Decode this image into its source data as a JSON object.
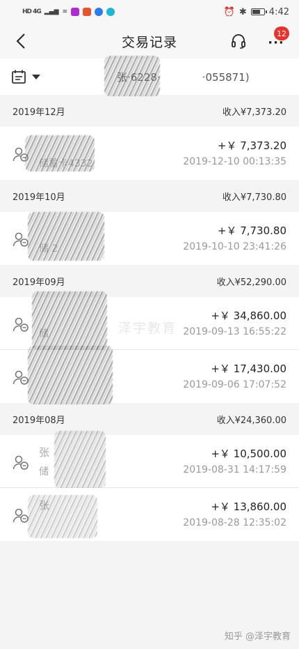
{
  "status_bar": {
    "left_indicators": "HD 4G",
    "time": "4:42"
  },
  "nav": {
    "title": "交易记录",
    "badge_count": "12"
  },
  "filter": {
    "account_text": "张·6228·    ·055871)"
  },
  "groups": [
    {
      "month": "2019年12月",
      "total": "收入¥7,373.20",
      "transactions": [
        {
          "name": "",
          "sub": "储蓄卡4332",
          "amount": "+￥ 7,373.20",
          "time": "2019-12-10 00:13:35"
        }
      ]
    },
    {
      "month": "2019年10月",
      "total": "收入¥7,730.80",
      "transactions": [
        {
          "name": "",
          "sub": "储  2",
          "amount": "+￥ 7,730.80",
          "time": "2019-10-10 23:41:26"
        }
      ]
    },
    {
      "month": "2019年09月",
      "total": "收入¥52,290.00",
      "transactions": [
        {
          "name": "",
          "sub": "储",
          "amount": "+￥ 34,860.00",
          "time": "2019-09-13 16:55:22"
        },
        {
          "name": "",
          "sub": "",
          "amount": "+￥ 17,430.00",
          "time": "2019-09-06 17:07:52"
        }
      ]
    },
    {
      "month": "2019年08月",
      "total": "收入¥24,360.00",
      "transactions": [
        {
          "name": "张",
          "sub": "储",
          "amount": "+￥ 10,500.00",
          "time": "2019-08-31 14:17:59"
        },
        {
          "name": "张",
          "sub": "",
          "amount": "+￥ 13,860.00",
          "time": "2019-08-28 12:35:02"
        }
      ]
    }
  ],
  "watermarks": {
    "center": "泽宇教育",
    "bottom": "知乎 @泽宇教育"
  },
  "colors": {
    "badge": "#e8332c",
    "page_bg": "#f4f4f4",
    "card_bg": "#ffffff"
  },
  "icons": {
    "back": "chevron-left-icon",
    "headset": "headset-icon",
    "more": "more-dots-icon",
    "calendar": "calendar-icon",
    "transfer": "person-transfer-icon"
  }
}
